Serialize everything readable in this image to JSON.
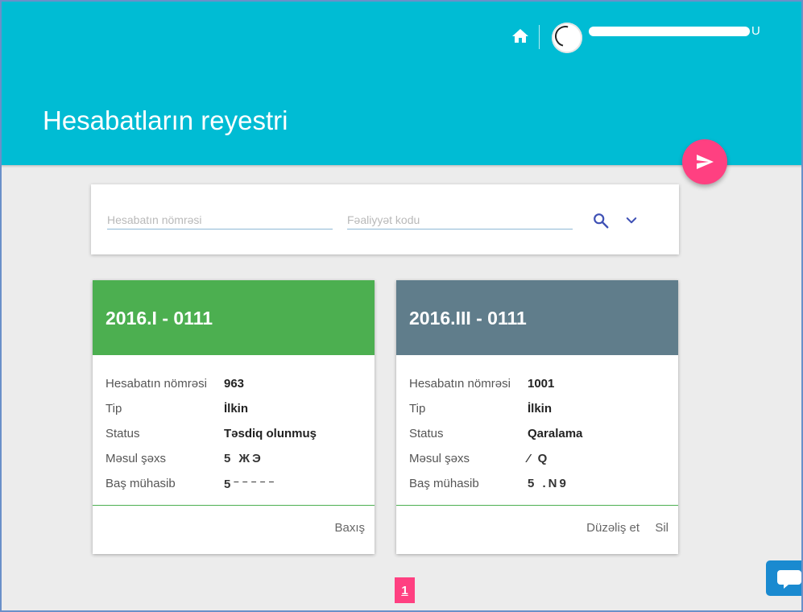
{
  "header": {
    "title": "Hesabatların reyestri",
    "user_name_suffix": "U"
  },
  "search": {
    "number_placeholder": "Hesabatın nömrəsi",
    "activity_placeholder": "Fəaliyyət kodu"
  },
  "cards": [
    {
      "title": "2016.I - 0111",
      "header_color": "#4caf50",
      "rows": [
        {
          "label": "Hesabatın nömrəsi",
          "value": "963"
        },
        {
          "label": "Tip",
          "value": "İlkin"
        },
        {
          "label": "Status",
          "value": "Təsdiq olunmuş"
        },
        {
          "label": "Məsul şəxs",
          "value": "5  ЖЭ"
        },
        {
          "label": "Baş mühasib",
          "value": "5⁻⁻⁻⁻⁻"
        }
      ],
      "actions": [
        "Baxış"
      ]
    },
    {
      "title": "2016.III - 0111",
      "header_color": "#607d8b",
      "rows": [
        {
          "label": "Hesabatın nömrəsi",
          "value": "1001"
        },
        {
          "label": "Tip",
          "value": "İlkin"
        },
        {
          "label": "Status",
          "value": "Qaralama"
        },
        {
          "label": "Məsul şəxs",
          "value": "⁄   Q"
        },
        {
          "label": "Baş mühasib",
          "value": "5 .N9"
        }
      ],
      "actions": [
        "Düzəliş et",
        "Sil"
      ]
    }
  ],
  "pagination": {
    "current_page": "1"
  },
  "colors": {
    "header": "#00bcd4",
    "fab": "#ff4081",
    "pager": "#ff4081",
    "chat": "#1a8ad0"
  },
  "icons": [
    "home-icon",
    "user-avatar",
    "send-icon",
    "search-icon",
    "chevron-down-icon",
    "chat-icon"
  ]
}
